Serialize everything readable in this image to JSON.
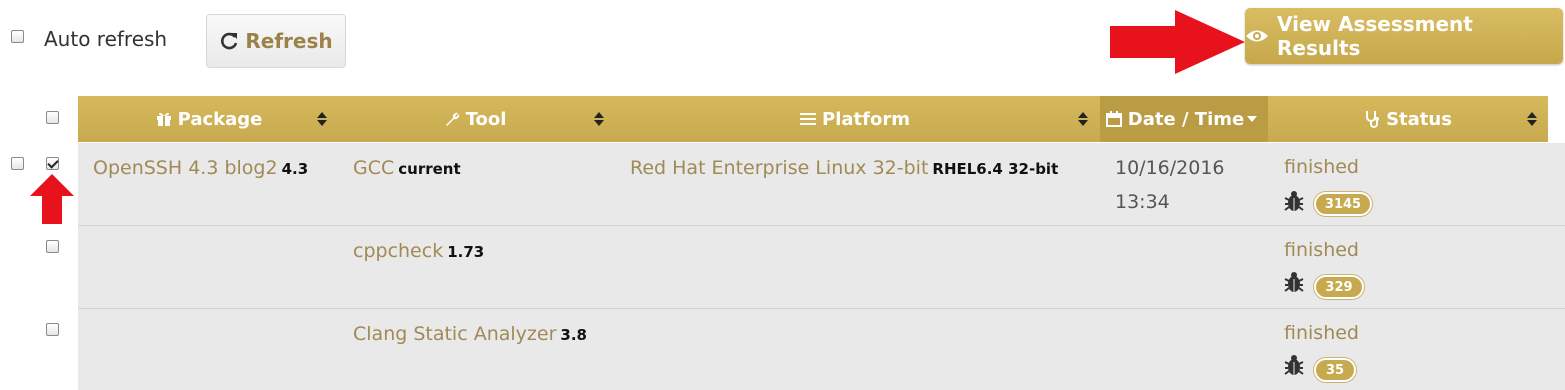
{
  "toolbar": {
    "auto_refresh_label": "Auto refresh",
    "refresh_label": "Refresh",
    "view_results_label": "View Assessment Results"
  },
  "table": {
    "headers": [
      {
        "label": "Package",
        "icon": "gift-icon"
      },
      {
        "label": "Tool",
        "icon": "wrench-icon"
      },
      {
        "label": "Platform",
        "icon": "bars-icon"
      },
      {
        "label": "Date / Time",
        "icon": "calendar-icon"
      },
      {
        "label": "Status",
        "icon": "stethoscope-icon"
      }
    ],
    "rows": [
      {
        "checked": true,
        "package": "OpenSSH 4.3 blog2",
        "package_version": "4.3",
        "tool": "GCC",
        "tool_version": "current",
        "platform": "Red Hat Enterprise Linux 32-bit",
        "platform_version": "RHEL6.4 32-bit",
        "date": "10/16/2016",
        "time": "13:34",
        "status": "finished",
        "bug_count": "3145"
      },
      {
        "checked": false,
        "package": "",
        "package_version": "",
        "tool": "cppcheck",
        "tool_version": "1.73",
        "platform": "",
        "platform_version": "",
        "date": "",
        "time": "",
        "status": "finished",
        "bug_count": "329"
      },
      {
        "checked": false,
        "package": "",
        "package_version": "",
        "tool": "Clang Static Analyzer",
        "tool_version": "3.8",
        "platform": "",
        "platform_version": "",
        "date": "",
        "time": "",
        "status": "finished",
        "bug_count": "35"
      }
    ]
  },
  "colors": {
    "accent": "#c7aa4f",
    "link_text": "#a08a55",
    "arrow": "#e8121c",
    "row_bg": "#e9e9e9"
  }
}
